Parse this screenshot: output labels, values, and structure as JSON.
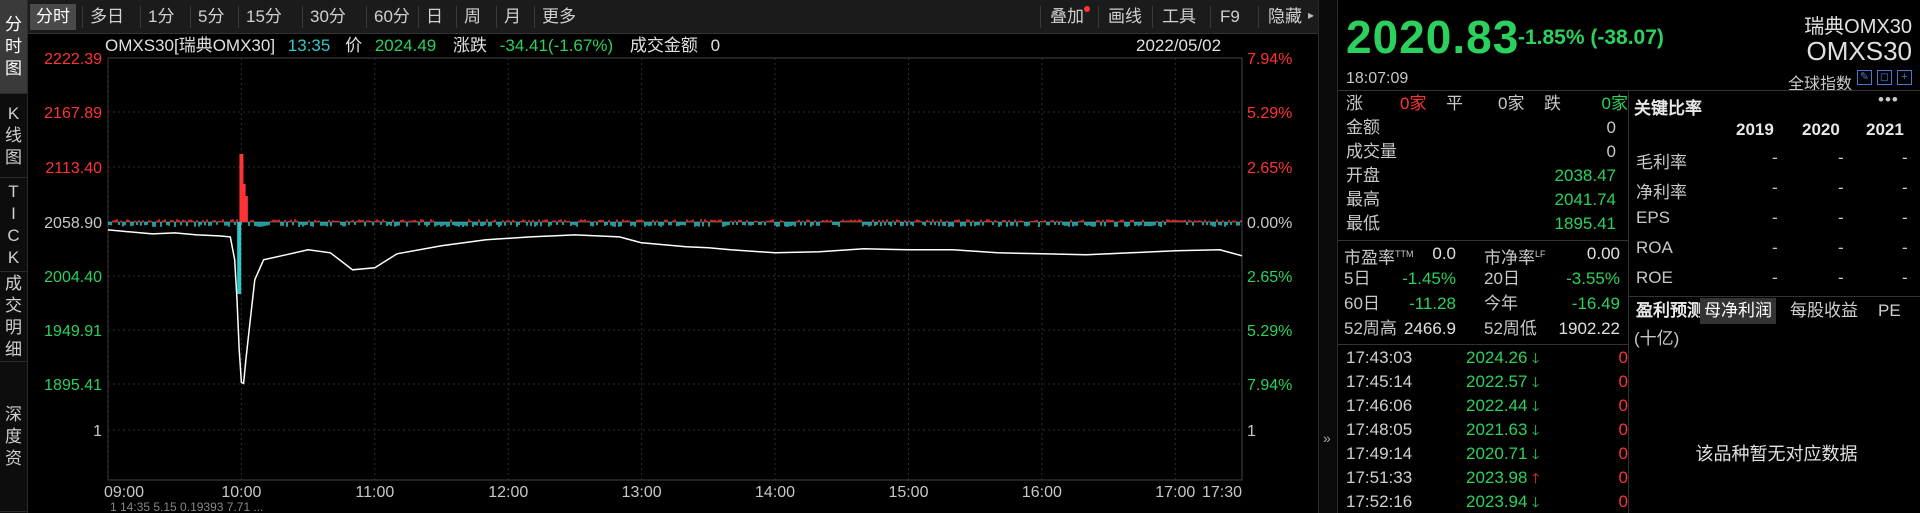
{
  "left_tabs": [
    {
      "label": "分时图",
      "active": true
    },
    {
      "label": "K线图",
      "active": false
    },
    {
      "label": "TICK",
      "active": false
    },
    {
      "label": "成交明细",
      "active": false
    },
    {
      "label": "深度资",
      "active": false
    }
  ],
  "toolbar": {
    "periods": [
      "分时",
      "多日",
      "1分",
      "5分",
      "15分",
      "30分",
      "60分",
      "日",
      "周",
      "月",
      "更多"
    ],
    "active_period": "分时",
    "tools": [
      "叠加",
      "画线",
      "工具",
      "F9",
      "隐藏"
    ]
  },
  "infobar": {
    "code_name": "OMXS30[瑞典OMX30]",
    "time": "13:35",
    "price_label": "价",
    "price": "2024.49",
    "change_label": "涨跌",
    "change": "-34.41(-1.67%)",
    "amount_label": "成交金额",
    "amount": "0",
    "date": "2022/05/02"
  },
  "chart_data": {
    "type": "line",
    "y_ticks": [
      "2222.39",
      "2167.89",
      "2113.40",
      "2058.90",
      "2004.40",
      "1949.91",
      "1895.41",
      "1"
    ],
    "pct_ticks": [
      "7.94%",
      "5.29%",
      "2.65%",
      "0.00%",
      "2.65%",
      "5.29%",
      "7.94%",
      "1"
    ],
    "x_ticks": [
      "09:00",
      "10:00",
      "11:00",
      "12:00",
      "13:00",
      "14:00",
      "15:00",
      "16:00",
      "17:00",
      "17:30"
    ],
    "ylim": [
      1895.41,
      2222.39
    ],
    "prev_close": 2058.9,
    "price_series": {
      "t": [
        0,
        5,
        10,
        20,
        30,
        40,
        50,
        55,
        57,
        58,
        59,
        60,
        61,
        62,
        64,
        66,
        70,
        80,
        90,
        100,
        110,
        120,
        130,
        150,
        170,
        190,
        210,
        230,
        240,
        250,
        260,
        270,
        280,
        300,
        320,
        340,
        360,
        380,
        400,
        420,
        440,
        460,
        480,
        500,
        510
      ],
      "v": [
        2050,
        2049,
        2048,
        2046,
        2047,
        2045,
        2044,
        2043,
        2020,
        1980,
        1930,
        1897,
        1896,
        1920,
        1960,
        2000,
        2020,
        2025,
        2030,
        2027,
        2010,
        2012,
        2026,
        2034,
        2040,
        2043,
        2045,
        2043,
        2037,
        2035,
        2033,
        2032,
        2030,
        2027,
        2028,
        2031,
        2030,
        2030,
        2027,
        2026,
        2025,
        2027,
        2029,
        2030,
        2024
      ]
    },
    "volume_spikes": [
      {
        "t": 60,
        "v": 68
      },
      {
        "t": 61,
        "v": 38
      },
      {
        "t": 62,
        "v": 26
      },
      {
        "t": 59,
        "v": -72
      }
    ]
  },
  "bottom_status": "1 14:35  5.15  0.19393  7.71  ...",
  "rpanel": {
    "price": "2020.83",
    "pct_change": "-1.85% (-38.07)",
    "name_cn": "瑞典OMX30",
    "name_code": "OMXS30",
    "clock": "18:07:09",
    "global_index": "全球指数",
    "advance": {
      "up_label": "涨",
      "up": "0家",
      "flat_label": "平",
      "flat": "0家",
      "down_label": "跌",
      "down": "0家"
    },
    "stats": [
      {
        "label": "金额",
        "value": "0"
      },
      {
        "label": "成交量",
        "value": "0"
      },
      {
        "label": "开盘",
        "value": "2038.47"
      },
      {
        "label": "最高",
        "value": "2041.74"
      },
      {
        "label": "最低",
        "value": "1895.41"
      }
    ],
    "ratios": [
      {
        "l1": "市盈率",
        "s1": "TTM",
        "v1": "0.0",
        "l2": "市净率",
        "s2": "LF",
        "v2": "0.00"
      },
      {
        "l1": "5日",
        "s1": "",
        "v1": "-1.45%",
        "l2": "20日",
        "s2": "",
        "v2": "-3.55%"
      },
      {
        "l1": "60日",
        "s1": "",
        "v1": "-11.28",
        "l2": "今年",
        "s2": "",
        "v2": "-16.49"
      },
      {
        "l1": "52周高",
        "s1": "",
        "v1": "2466.9",
        "l2": "52周低",
        "s2": "",
        "v2": "1902.22"
      }
    ],
    "ticks": [
      {
        "time": "17:43:03",
        "price": "2024.26",
        "dir": "down",
        "vol": "0"
      },
      {
        "time": "17:45:14",
        "price": "2022.57",
        "dir": "down",
        "vol": "0"
      },
      {
        "time": "17:46:06",
        "price": "2022.44",
        "dir": "down",
        "vol": "0"
      },
      {
        "time": "17:48:05",
        "price": "2021.63",
        "dir": "down",
        "vol": "0"
      },
      {
        "time": "17:49:14",
        "price": "2020.71",
        "dir": "down",
        "vol": "0"
      },
      {
        "time": "17:51:33",
        "price": "2023.98",
        "dir": "up",
        "vol": "0"
      },
      {
        "time": "17:52:16",
        "price": "2023.94",
        "dir": "down",
        "vol": "0"
      }
    ],
    "key_ratios": {
      "title": "关键比率",
      "more": "•••",
      "years": [
        "2019",
        "2020",
        "2021"
      ],
      "rows": [
        "毛利率",
        "净利率",
        "EPS",
        "ROA",
        "ROE"
      ],
      "dash": "-"
    },
    "forecast_tabs": [
      "盈利预测",
      "母净利润",
      "每股收益",
      "PE"
    ],
    "active_forecast_tab": "母净利润",
    "unit": "(十亿)",
    "no_data": "该品种暂无对应数据"
  },
  "colors": {
    "up": "#ff3333",
    "down": "#2bd15c",
    "price_line": "#ffffff",
    "volume_down": "#33c8c8",
    "grid": "#333333"
  }
}
